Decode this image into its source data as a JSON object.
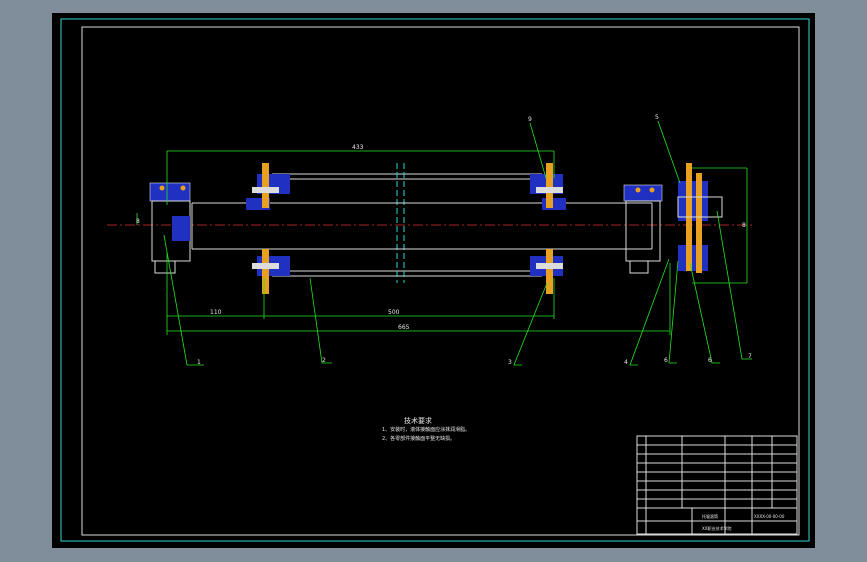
{
  "drawing": {
    "dimensions": {
      "top": "433",
      "left": "110",
      "middle": "500",
      "overall": "665",
      "left_vertical": "8",
      "right_vertical": "8"
    },
    "balloons": [
      "1",
      "2",
      "3",
      "4",
      "6",
      "6",
      "7",
      "9",
      "5"
    ],
    "technical_requirements": {
      "title": "技术要求",
      "items": [
        "1、安装时，滚体接触面应涂抹润滑脂。",
        "2、各零部件接触面平整无缺损。"
      ]
    },
    "title_block": {
      "drawing_title": "托辊滚筒",
      "company": "XX职业技术学院",
      "drawing_code": "XXXX-00-00-00"
    }
  },
  "colors": {
    "sheet": "#000000",
    "outline": "#25e325",
    "part": "#dcdcdc",
    "centerline": "#e03030",
    "frame": "#2fd6d6",
    "section": "#2030c0",
    "bolt": "#e8a020"
  }
}
